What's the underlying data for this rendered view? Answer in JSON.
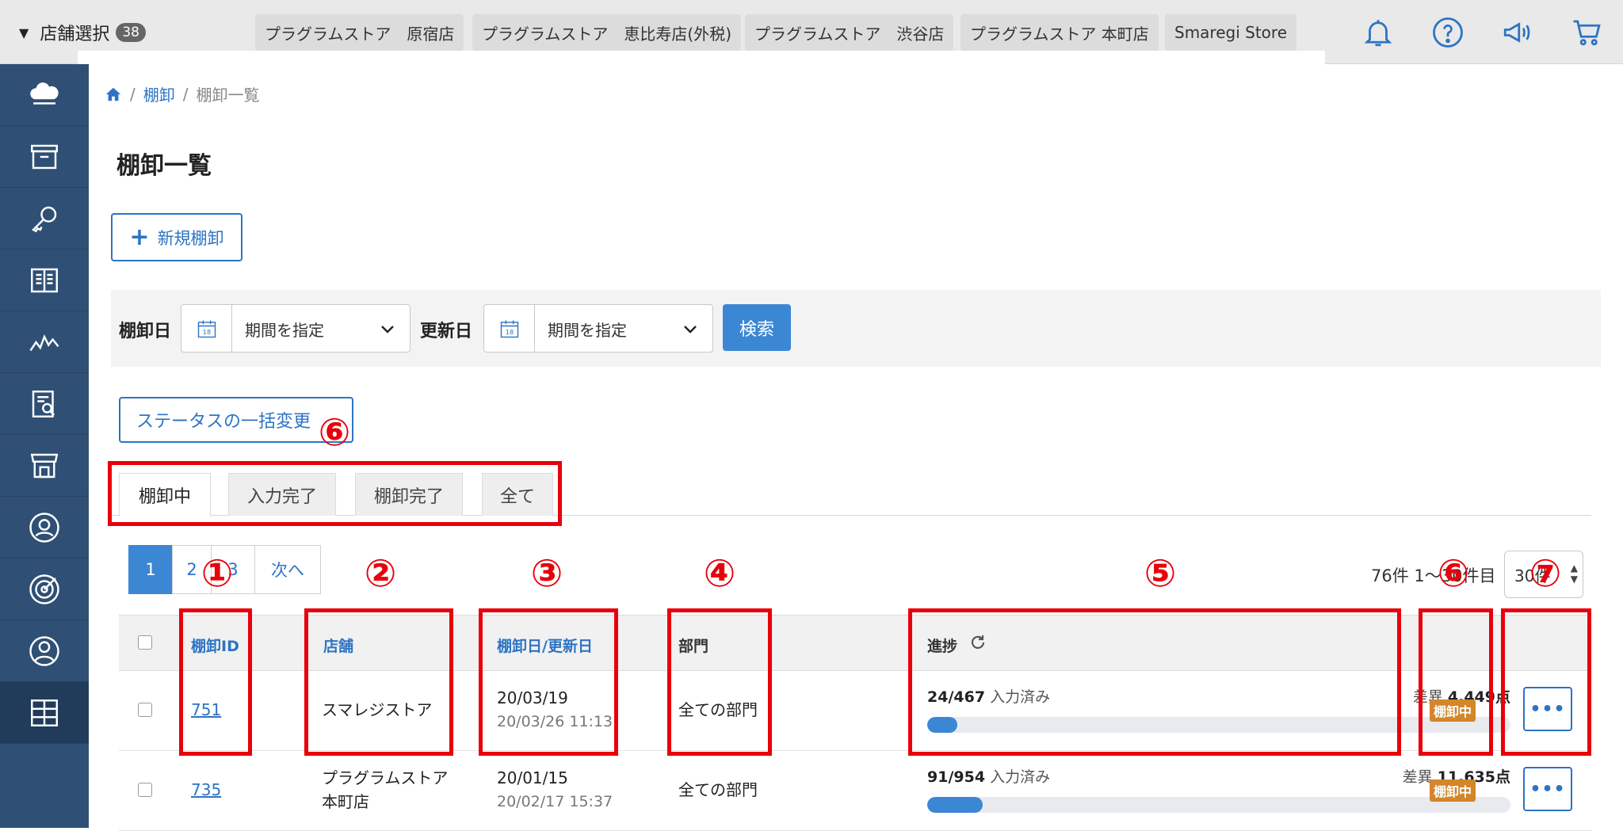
{
  "topbar": {
    "store_select_label": "店舗選択",
    "store_count": "38",
    "stores": [
      "プラグラムストア　原宿店",
      "プラグラムストア　恵比寿店(外税)",
      "プラグラムストア　渋谷店",
      "プラグラムストア 本町店",
      "Smaregi Store"
    ]
  },
  "breadcrumb": {
    "sep": "/",
    "items": [
      "棚卸",
      "棚卸一覧"
    ]
  },
  "page_title": "棚卸一覧",
  "new_button": "新規棚卸",
  "filter": {
    "inventory_date_label": "棚卸日",
    "updated_date_label": "更新日",
    "period_placeholder": "期間を指定",
    "calendar_day": "18",
    "search_button": "検索"
  },
  "status_bulk_button": "ステータスの一括変更",
  "tabs": [
    "棚卸中",
    "入力完了",
    "棚卸完了",
    "全て"
  ],
  "pagination": {
    "pages": [
      "1",
      "2",
      "3"
    ],
    "next": "次へ",
    "count_text": "76件 1〜30件目",
    "per_page": "30件"
  },
  "table": {
    "headers": {
      "id": "棚卸ID",
      "store": "店舗",
      "date": "棚卸日/更新日",
      "dept": "部門",
      "progress": "進捗"
    },
    "rows": [
      {
        "id": "751",
        "store_line1": "スマレジストア",
        "store_line2": "",
        "date": "20/03/19",
        "updated": "20/03/26 11:13",
        "dept": "全ての部門",
        "progress_count": "24/467",
        "progress_label": "入力済み",
        "diff_label": "差異",
        "diff_value": "4,449点",
        "progress_ratio": 0.051,
        "status": "棚卸中",
        "more": "•••"
      },
      {
        "id": "735",
        "store_line1": "プラグラムストア",
        "store_line2": "本町店",
        "date": "20/01/15",
        "updated": "20/02/17 15:37",
        "dept": "全ての部門",
        "progress_count": "91/954",
        "progress_label": "入力済み",
        "diff_label": "差異",
        "diff_value": "11,635点",
        "progress_ratio": 0.095,
        "status": "棚卸中",
        "more": "•••"
      }
    ]
  },
  "annotations": [
    "①",
    "②",
    "③",
    "④",
    "⑤",
    "⑥",
    "⑥",
    "⑦"
  ],
  "colors": {
    "accent": "#2d74c4",
    "sidebar": "#2f4f74",
    "status_badge": "#d4862a",
    "annotation": "#e8000b"
  }
}
